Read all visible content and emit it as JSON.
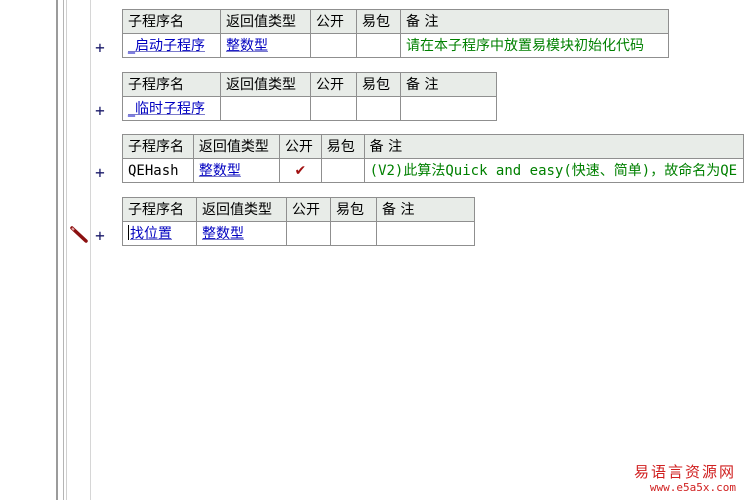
{
  "header": {
    "name": "子程序名",
    "return_type": "返回值类型",
    "public": "公开",
    "easy_pack": "易包",
    "remark": "备 注"
  },
  "expand_symbol": "+",
  "subroutines": [
    {
      "name": "_启动子程序",
      "return_type": "整数型",
      "public": "",
      "easy_pack": "",
      "remark": "请在本子程序中放置易模块初始化代码"
    },
    {
      "name": "_临时子程序",
      "return_type": "",
      "public": "",
      "easy_pack": "",
      "remark": ""
    },
    {
      "name": "QEHash",
      "return_type": "整数型",
      "public": "✔",
      "easy_pack": "",
      "remark": "(V2)此算法Quick and easy(快速、简单)，故命名为QE"
    },
    {
      "name": "找位置",
      "return_type": "整数型",
      "public": "",
      "easy_pack": "",
      "remark": ""
    }
  ],
  "watermark": {
    "title": "易语言资源网",
    "url": "www.e5a5x.com"
  },
  "colors": {
    "header_bg": "#e8ece8",
    "link_blue": "#0000c0",
    "remark_green": "#008000",
    "check_red": "#a01010",
    "watermark_red": "#d02020"
  }
}
